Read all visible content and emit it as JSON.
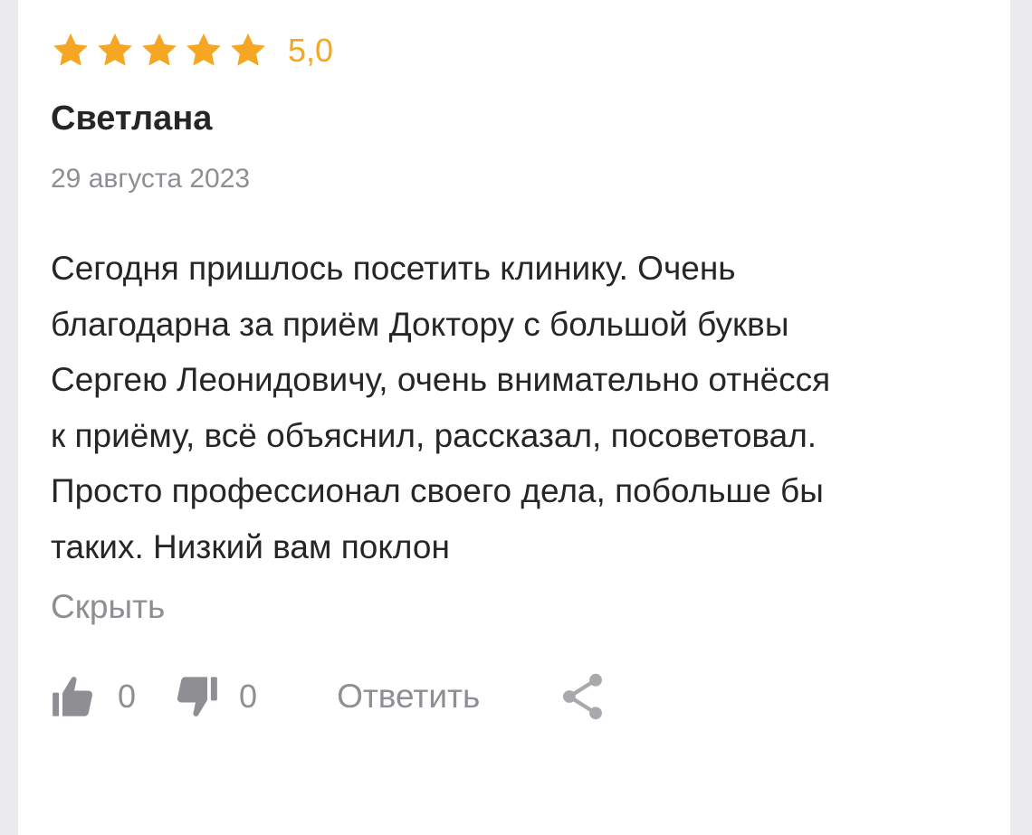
{
  "rating": {
    "stars_filled": 5,
    "stars_total": 5,
    "value_text": "5,0",
    "star_color": "#f5a623"
  },
  "author": "Светлана",
  "date": "29 августа 2023",
  "review_text": "Сегодня пришлось посетить клинику. Очень\nблагодарна за приём Доктору с большой буквы\nСергею Леонидовичу, очень внимательно отнёсся\nк приёму, всё объяснил, рассказал, посоветовал.\nПросто профессионал своего дела, побольше бы\nтаких. Низкий вам поклон",
  "collapse_label": "Скрыть",
  "actions": {
    "like_icon": "thumbs-up-icon",
    "like_count": "0",
    "dislike_icon": "thumbs-down-icon",
    "dislike_count": "0",
    "reply_label": "Ответить",
    "share_icon": "share-icon",
    "icon_color": "#8e8e93"
  }
}
